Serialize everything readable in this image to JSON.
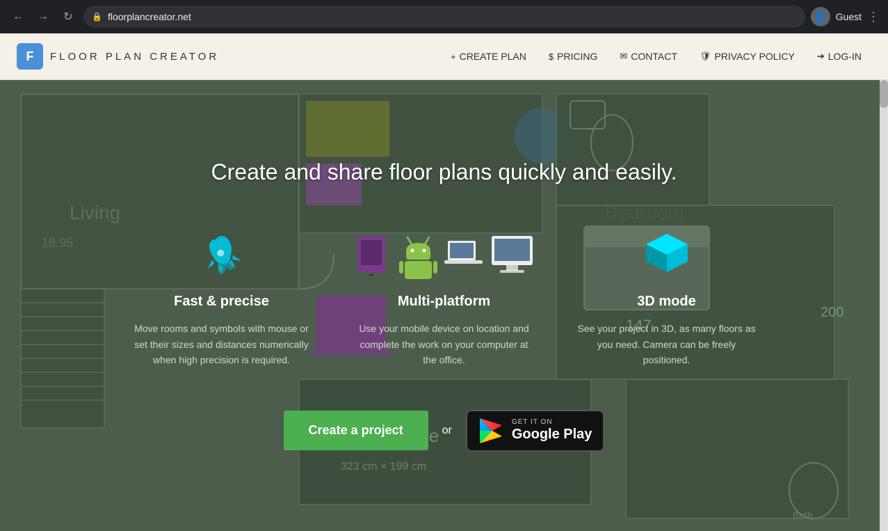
{
  "browser": {
    "back_label": "←",
    "forward_label": "→",
    "reload_label": "↺",
    "url": "floorplancreator.net",
    "user_label": "Guest",
    "menu_label": "⋮"
  },
  "header": {
    "logo_letter": "F",
    "logo_text": "FLOOR PLAN CREATOR",
    "nav": [
      {
        "id": "create-plan",
        "icon": "+",
        "label": "CREATE PLAN"
      },
      {
        "id": "pricing",
        "icon": "$",
        "label": "PRICING"
      },
      {
        "id": "contact",
        "icon": "✉",
        "label": "CONTACT"
      },
      {
        "id": "privacy",
        "icon": "🛡",
        "label": "PRIVACY POLICY"
      },
      {
        "id": "login",
        "icon": "→",
        "label": "LOG-IN"
      }
    ]
  },
  "hero": {
    "title": "Create and share floor plans quickly and easily.",
    "features": [
      {
        "id": "fast-precise",
        "icon": "rocket",
        "icon_color": "#00bcd4",
        "title": "Fast & precise",
        "description": "Move rooms and symbols with mouse or set their sizes and distances numerically when high precision is required."
      },
      {
        "id": "multi-platform",
        "icon": "multiplatform",
        "title": "Multi-platform",
        "description": "Use your mobile device on location and complete the work on your computer at the office."
      },
      {
        "id": "3d-mode",
        "icon": "cube",
        "icon_color": "#00bcd4",
        "title": "3D mode",
        "description": "See your project in 3D, as many floors as you need. Camera can be freely positioned."
      }
    ],
    "cta_button": "Create a project",
    "or_text": "or",
    "google_play_small": "GET IT ON",
    "google_play_large": "Google Play"
  }
}
